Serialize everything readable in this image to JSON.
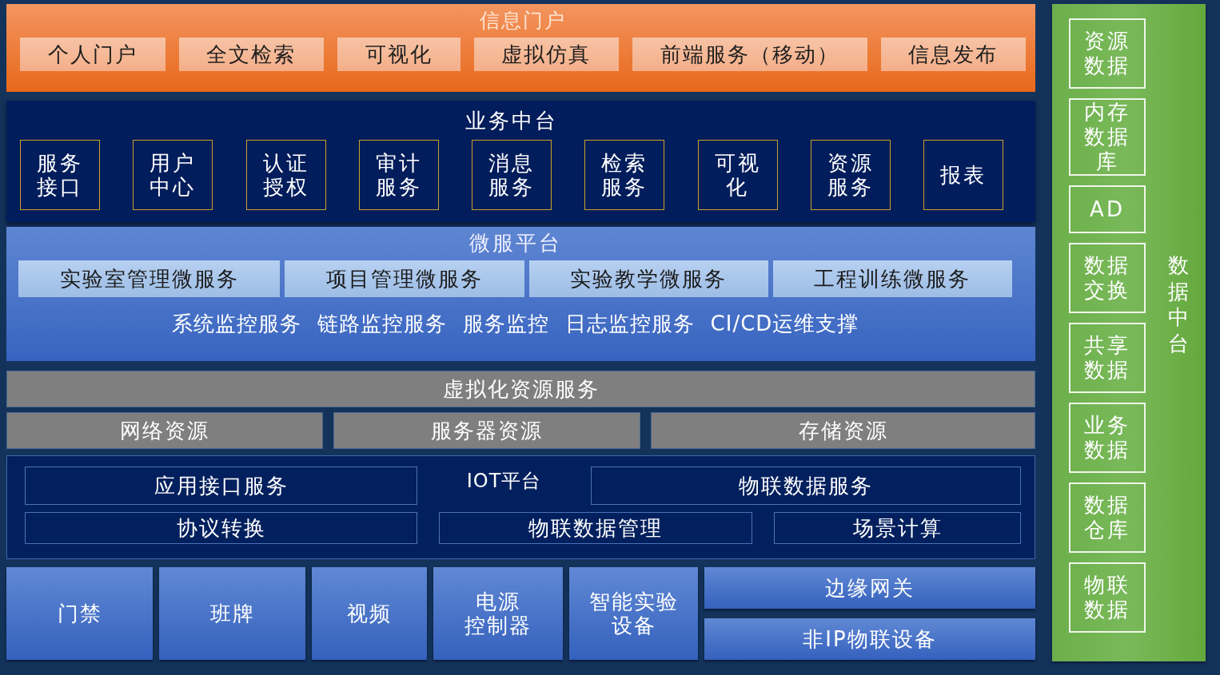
{
  "portal": {
    "title": "信息门户",
    "items": [
      "个人门户",
      "全文检索",
      "可视化",
      "虚拟仿真",
      "前端服务（移动）",
      "信息发布"
    ]
  },
  "business": {
    "title": "业务中台",
    "items": [
      {
        "lines": [
          "服务",
          "接口"
        ]
      },
      {
        "lines": [
          "用户",
          "中心"
        ]
      },
      {
        "lines": [
          "认证",
          "授权"
        ]
      },
      {
        "lines": [
          "审计",
          "服务"
        ]
      },
      {
        "lines": [
          "消息",
          "服务"
        ]
      },
      {
        "lines": [
          "检索",
          "服务"
        ]
      },
      {
        "lines": [
          "可视",
          "化"
        ]
      },
      {
        "lines": [
          "资源",
          "服务"
        ]
      },
      {
        "lines": [
          "报表"
        ]
      }
    ]
  },
  "microservice": {
    "title": "微服平台",
    "services": [
      "实验室管理微服务",
      "项目管理微服务",
      "实验教学微服务",
      "工程训练微服务"
    ],
    "monitoring": [
      "系统监控服务",
      "链路监控服务",
      "服务监控",
      "日志监控服务",
      "CI/CD运维支撑"
    ]
  },
  "virtualization": {
    "title": "虚拟化资源服务",
    "resources": [
      "网络资源",
      "服务器资源",
      "存储资源"
    ]
  },
  "iot": {
    "title": "IOT平台",
    "row_1": [
      "应用接口服务",
      "物联数据服务"
    ],
    "row_2": [
      "协议转换",
      "物联数据管理",
      "场景计算"
    ]
  },
  "devices": {
    "items": [
      {
        "lines": [
          "门禁"
        ]
      },
      {
        "lines": [
          "班牌"
        ]
      },
      {
        "lines": [
          "视频"
        ]
      },
      {
        "lines": [
          "电源",
          "控制器"
        ]
      },
      {
        "lines": [
          "智能实验",
          "设备"
        ]
      }
    ],
    "gateways": [
      "边缘网关",
      "非IP物联设备"
    ]
  },
  "data_platform": {
    "title": "数据中台",
    "items": [
      {
        "lines": [
          "资源",
          "数据"
        ]
      },
      {
        "lines": [
          "内存",
          "数据",
          "库"
        ]
      },
      {
        "lines": [
          "AD"
        ]
      },
      {
        "lines": [
          "数据",
          "交换"
        ]
      },
      {
        "lines": [
          "共享",
          "数据"
        ]
      },
      {
        "lines": [
          "业务",
          "数据"
        ]
      },
      {
        "lines": [
          "数据",
          "仓库"
        ]
      },
      {
        "lines": [
          "物联",
          "数据"
        ]
      }
    ]
  }
}
